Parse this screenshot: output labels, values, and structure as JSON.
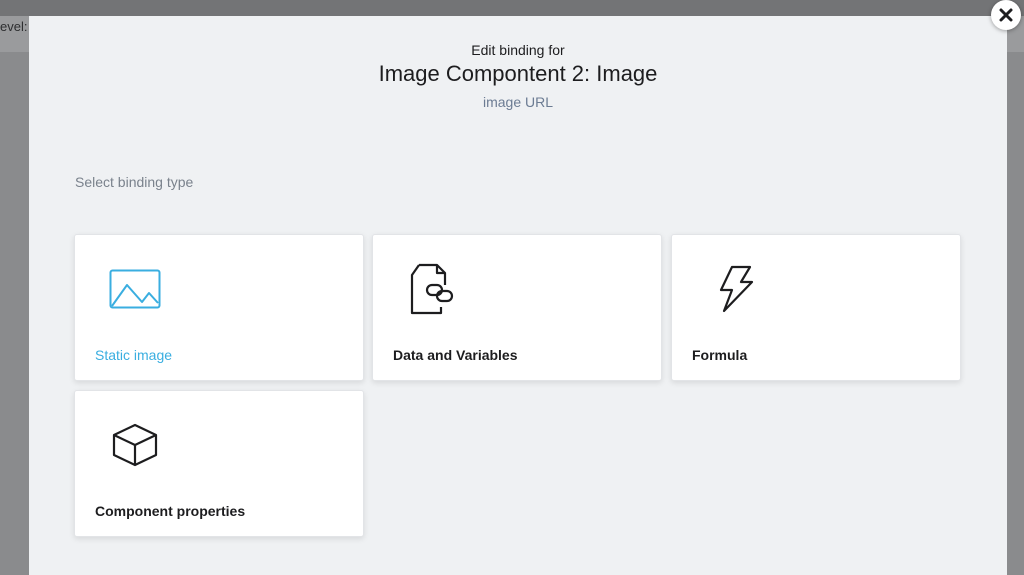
{
  "background": {
    "partial_text": "evel:"
  },
  "dialog": {
    "subtitle": "Edit binding for",
    "title": "Image Compontent 2: Image",
    "property": "image URL",
    "section_label": "Select binding type",
    "options": [
      {
        "label": "Static image",
        "icon": "image-icon",
        "selected": true
      },
      {
        "label": "Data and Variables",
        "icon": "linked-document-icon",
        "selected": false
      },
      {
        "label": "Formula",
        "icon": "lightning-icon",
        "selected": false
      },
      {
        "label": "Component properties",
        "icon": "cube-icon",
        "selected": false
      }
    ]
  },
  "colors": {
    "accent": "#3aaee0",
    "dialog_bg": "#eff1f3",
    "card_bg": "#ffffff",
    "overlay": "#8a8b8d"
  }
}
